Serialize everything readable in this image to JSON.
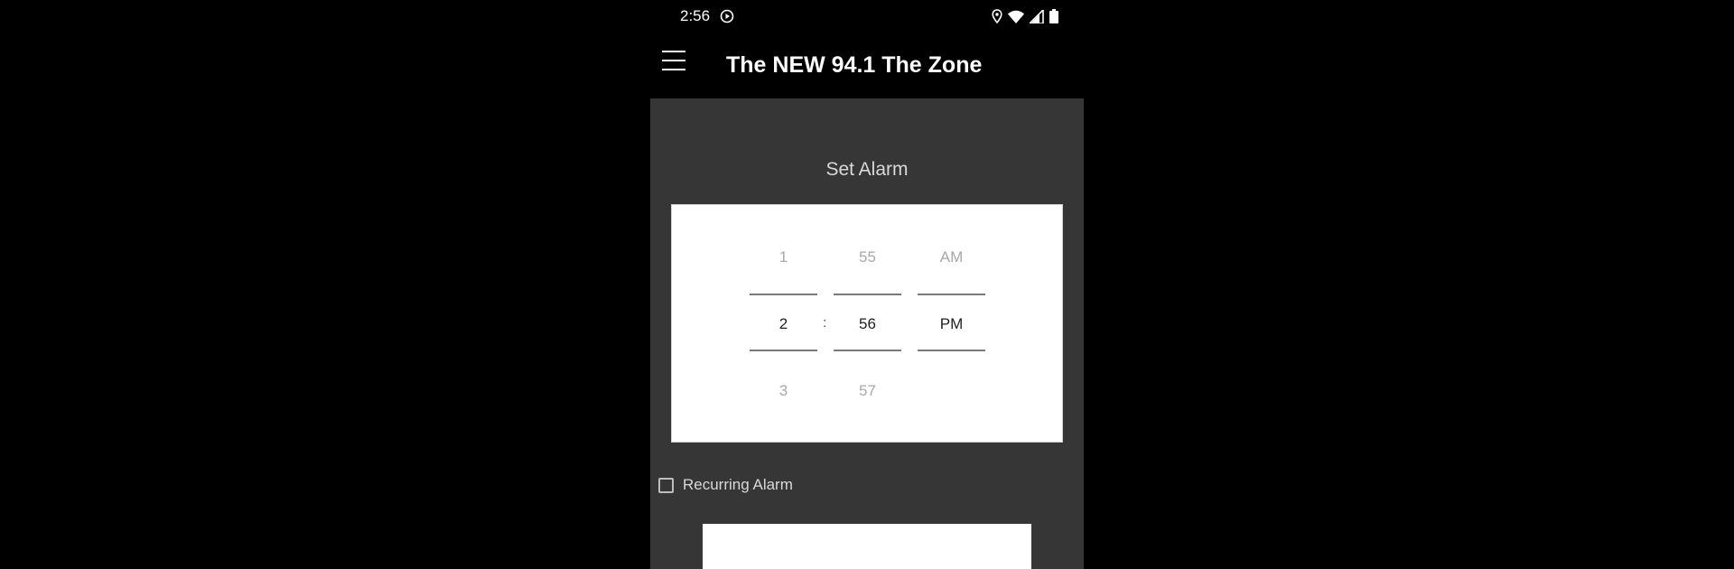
{
  "status_bar": {
    "time": "2:56",
    "icons": [
      "play-circle-icon",
      "location-icon",
      "wifi-icon",
      "signal-icon",
      "battery-icon"
    ]
  },
  "app_bar": {
    "menu_icon": "hamburger-menu-icon",
    "title": "The NEW 94.1 The Zone"
  },
  "alarm": {
    "heading": "Set Alarm",
    "separator": ":",
    "hours": {
      "prev": "1",
      "current": "2",
      "next": "3"
    },
    "minutes": {
      "prev": "55",
      "current": "56",
      "next": "57"
    },
    "ampm": {
      "prev": "AM",
      "current": "PM",
      "next": ""
    },
    "recurring_label": "Recurring Alarm",
    "recurring_checked": false
  },
  "colors": {
    "background": "#000000",
    "content_bg": "#363636",
    "card_bg": "#ffffff",
    "text_light": "#d9d9d9"
  }
}
